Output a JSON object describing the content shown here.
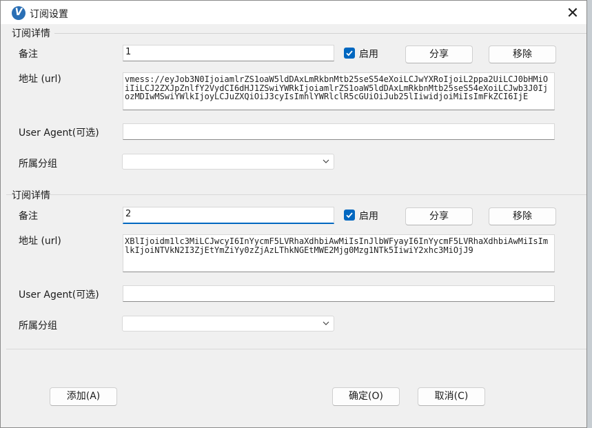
{
  "window": {
    "title": "订阅设置",
    "app_icon_letter": "V",
    "close_glyph": "✕"
  },
  "subscriptions": [
    {
      "group_title": "订阅详情",
      "remark_label": "备注",
      "remark_value": "1",
      "enabled_label": "启用",
      "enabled": true,
      "share_label": "分享",
      "remove_label": "移除",
      "url_label": "地址 (url)",
      "url_value": "vmess://eyJob3N0IjoiamlrZS1oaW5ldDAxLmRkbnMtb25seS54eXoiLCJwYXRoIjoiL2ppa2UiLCJ0bHMiOiIiLCJ2ZXJpZnlfY2VydCI6dHJ1ZSwiYWRkIjoiamlrZS1oaW5ldDAxLmRkbnMtb25seS54eXoiLCJwb3J0IjozMDIwMSwiYWlkIjoyLCJuZXQiOiJ3cyIsImhlYWRlclR5cGUiOiJub25lIiwidjoiMiIsImFkZCI6IjE",
      "ua_label": "User Agent(可选)",
      "ua_value": "",
      "group_label": "所属分组",
      "group_value": ""
    },
    {
      "group_title": "订阅详情",
      "remark_label": "备注",
      "remark_value": "2",
      "enabled_label": "启用",
      "enabled": true,
      "share_label": "分享",
      "remove_label": "移除",
      "url_label": "地址 (url)",
      "url_value": "XBlIjoidm1lc3MiLCJwcyI6InYycmF5LVRhaXdhbiAwMiIsInJlbWFyayI6InYycmF5LVRhaXdhbiAwMiIsImlkIjoiNTVkN2I3ZjEtYmZiYy0zZjAzLThkNGEtMWE2Mjg0Mzg1NTk5IiwiY2xhc3MiOjJ9",
      "ua_label": "User Agent(可选)",
      "ua_value": "",
      "group_label": "所属分组",
      "group_value": ""
    }
  ],
  "footer": {
    "add_label": "添加(A)",
    "ok_label": "确定(O)",
    "cancel_label": "取消(C)"
  },
  "colors": {
    "accent": "#0067c0",
    "window_bg": "#f0f0f0"
  }
}
